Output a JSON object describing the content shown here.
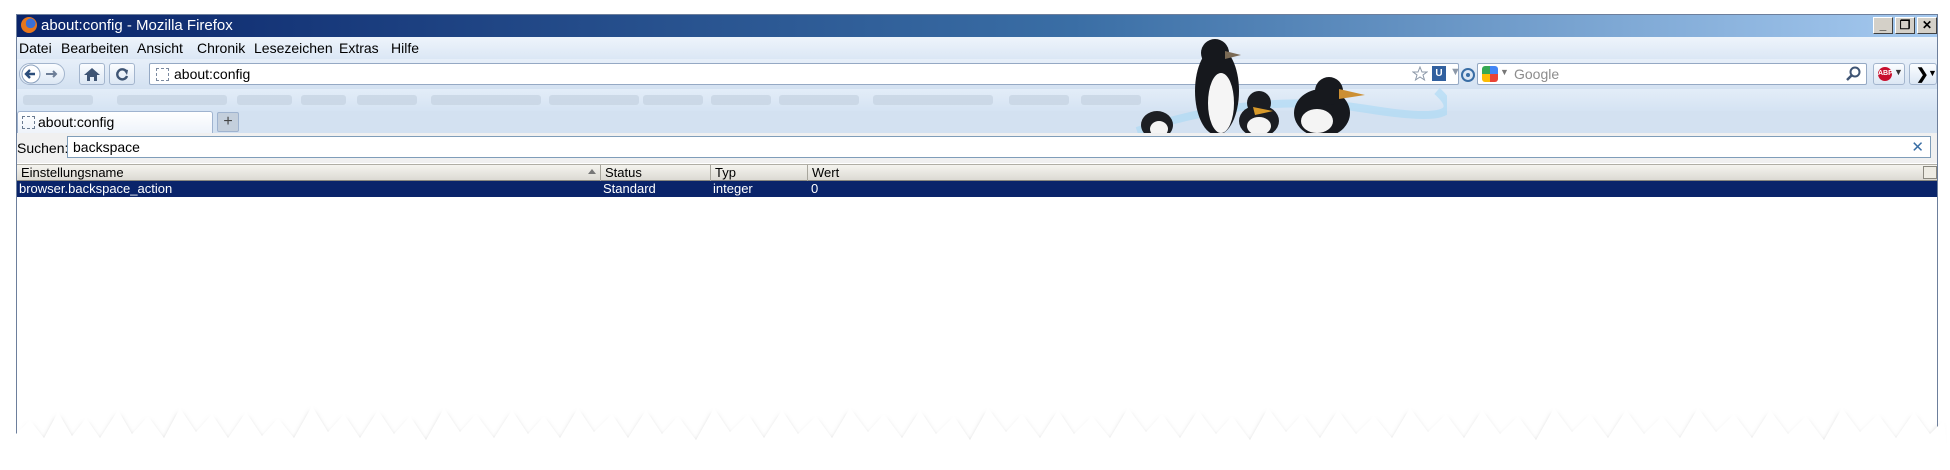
{
  "window": {
    "title": "about:config - Mozilla Firefox",
    "controls": [
      "minimize",
      "restore",
      "close"
    ]
  },
  "menu": [
    "Datei",
    "Bearbeiten",
    "Ansicht",
    "Chronik",
    "Lesezeichen",
    "Extras",
    "Hilfe"
  ],
  "navbar": {
    "url": "about:config",
    "search_placeholder": "Google"
  },
  "tabs": [
    {
      "label": "about:config"
    }
  ],
  "filter": {
    "label": "Suchen:",
    "value": "backspace"
  },
  "table": {
    "columns": [
      "Einstellungsname",
      "Status",
      "Typ",
      "Wert"
    ],
    "rows": [
      {
        "name": "browser.backspace_action",
        "status": "Standard",
        "type": "integer",
        "value": "0"
      }
    ]
  },
  "icons": [
    "firefox-icon",
    "back-icon",
    "forward-icon",
    "home-icon",
    "reload-icon",
    "bookmark-star-icon",
    "dropdown-icon",
    "google-icon",
    "magnifier-icon",
    "adblock-icon",
    "overflow-chevron-icon",
    "new-tab-icon",
    "clear-icon",
    "column-picker-icon"
  ],
  "colors": {
    "selection": "#0a246a",
    "titlebar": "#0a246a",
    "toolbar": "#dbe7f5"
  }
}
